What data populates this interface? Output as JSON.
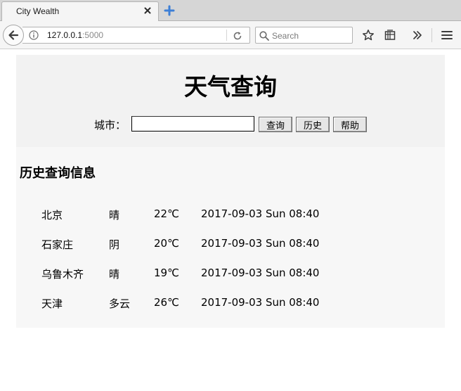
{
  "browser": {
    "tab_title": "City Wealth",
    "url_host": "127.0.0.1",
    "url_port": ":5000",
    "search_placeholder": "Search"
  },
  "page": {
    "title": "天气查询",
    "form": {
      "city_label": "城市：",
      "city_value": "",
      "query_button": "查询",
      "history_button": "历史",
      "help_button": "帮助"
    },
    "history_title": "历史查询信息",
    "history": [
      {
        "city": "北京",
        "weather": "晴",
        "temp": "22℃",
        "time": "2017-09-03 Sun 08:40"
      },
      {
        "city": "石家庄",
        "weather": "阴",
        "temp": "20℃",
        "time": "2017-09-03 Sun 08:40"
      },
      {
        "city": "乌鲁木齐",
        "weather": "晴",
        "temp": "19℃",
        "time": "2017-09-03 Sun 08:40"
      },
      {
        "city": "天津",
        "weather": "多云",
        "temp": "26℃",
        "time": "2017-09-03 Sun 08:40"
      }
    ]
  }
}
